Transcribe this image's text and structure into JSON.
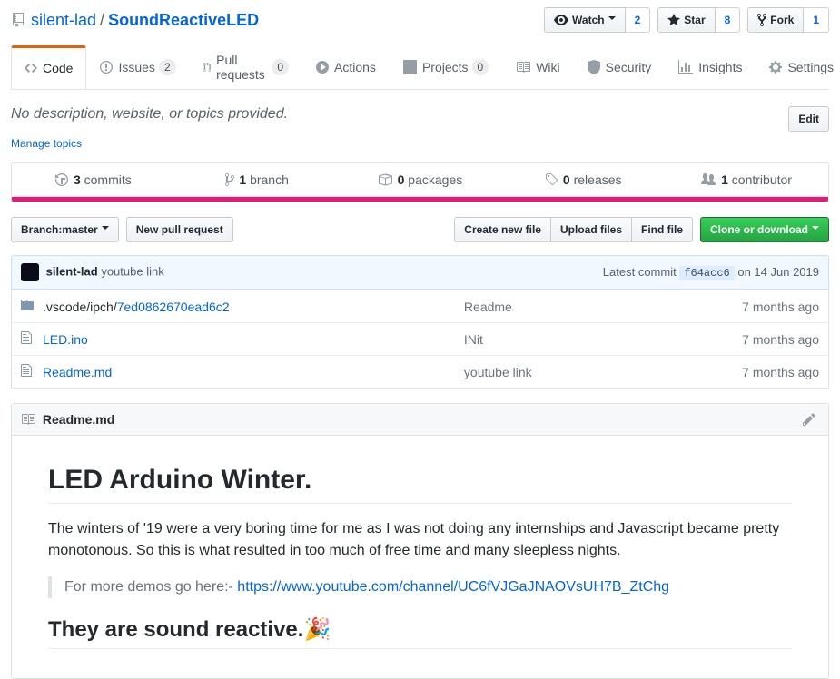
{
  "repohead": {
    "owner": "silent-lad",
    "separator": "/",
    "name": "SoundReactiveLED"
  },
  "actions": {
    "watch": {
      "label": "Watch",
      "count": "2"
    },
    "star": {
      "label": "Star",
      "count": "8"
    },
    "fork": {
      "label": "Fork",
      "count": "1"
    }
  },
  "tabs": {
    "code": "Code",
    "issues": {
      "label": "Issues",
      "count": "2"
    },
    "pulls": {
      "label": "Pull requests",
      "count": "0"
    },
    "actions": "Actions",
    "projects": {
      "label": "Projects",
      "count": "0"
    },
    "wiki": "Wiki",
    "security": "Security",
    "insights": "Insights",
    "settings": "Settings"
  },
  "meta": {
    "description": "No description, website, or topics provided.",
    "edit": "Edit",
    "manage_topics": "Manage topics"
  },
  "summary": {
    "commits": {
      "num": "3",
      "label": " commits"
    },
    "branches": {
      "num": "1",
      "label": " branch"
    },
    "packages": {
      "num": "0",
      "label": " packages"
    },
    "releases": {
      "num": "0",
      "label": " releases"
    },
    "contributors": {
      "num": "1",
      "label": " contributor"
    }
  },
  "filenav": {
    "branch_label": "Branch: ",
    "branch_name": "master",
    "new_pr": "New pull request",
    "create_file": "Create new file",
    "upload": "Upload files",
    "find": "Find file",
    "clone": "Clone or download"
  },
  "commit_tease": {
    "author": "silent-lad",
    "message": "youtube link",
    "latest_label": "Latest commit ",
    "sha": "f64acc6",
    "date": " on 14 Jun 2019"
  },
  "files": [
    {
      "type": "dir",
      "name_prefix": ".vscode/ipch/",
      "name_link": "7ed0862670ead6c2",
      "message": "Readme",
      "age": "7 months ago"
    },
    {
      "type": "file",
      "name_link": "LED.ino",
      "message": "INit",
      "age": "7 months ago"
    },
    {
      "type": "file",
      "name_link": "Readme.md",
      "message": "youtube link",
      "age": "7 months ago"
    }
  ],
  "readme": {
    "filename": "Readme.md",
    "h1": "LED Arduino Winter.",
    "p1": "The winters of '19 were a very boring time for me as I was not doing any internships and Javascript became pretty monotonous. So this is what resulted in too much of free time and many sleepless nights.",
    "bq_text": "For more demos go here:- ",
    "bq_link": "https://www.youtube.com/channel/UC6fVJGaJNAOVsUH7B_ZtChg",
    "h2": "They are sound reactive.🎉"
  }
}
